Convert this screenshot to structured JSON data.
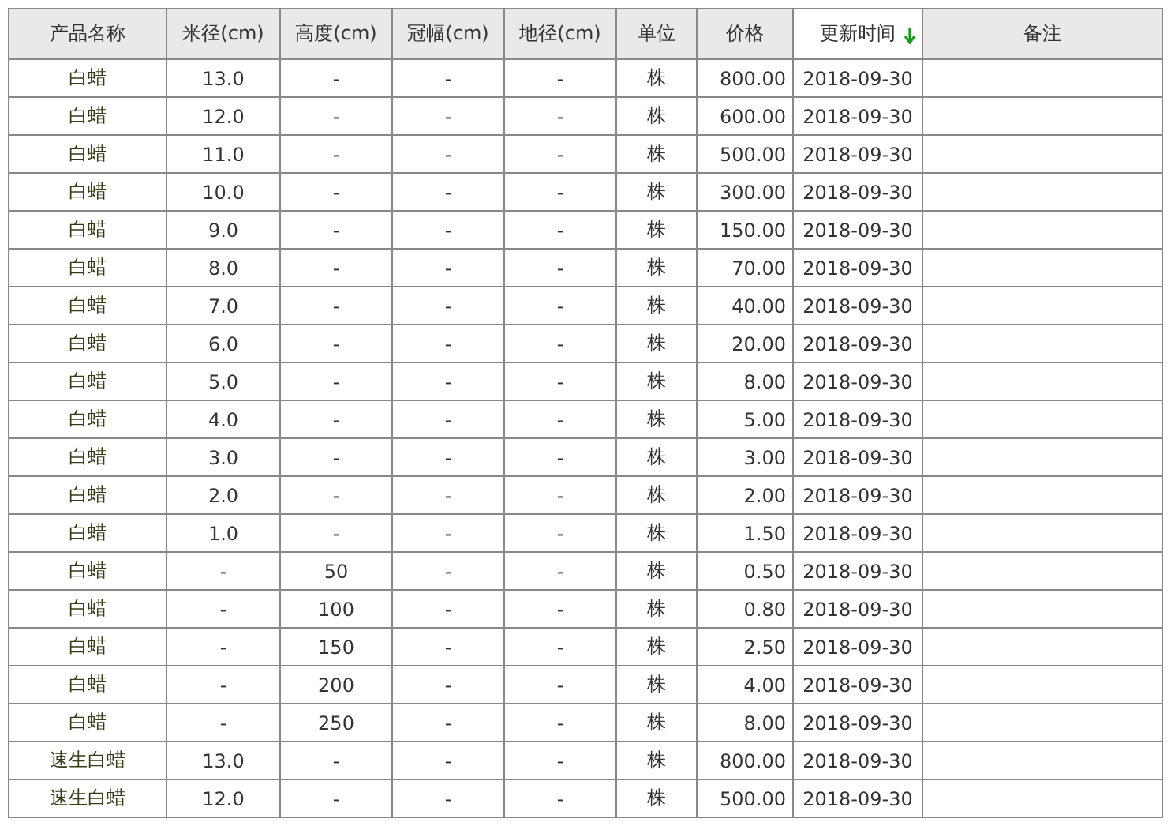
{
  "table": {
    "columns": [
      {
        "label": "产品名称",
        "sorted": false
      },
      {
        "label": "米径(cm)",
        "sorted": false
      },
      {
        "label": "高度(cm)",
        "sorted": false
      },
      {
        "label": "冠幅(cm)",
        "sorted": false
      },
      {
        "label": "地径(cm)",
        "sorted": false
      },
      {
        "label": "单位",
        "sorted": false
      },
      {
        "label": "价格",
        "sorted": false
      },
      {
        "label": "更新时间",
        "sorted": true
      },
      {
        "label": "备注",
        "sorted": false
      }
    ],
    "rows": [
      [
        "白蜡",
        "13.0",
        "-",
        "-",
        "-",
        "株",
        "800.00",
        "2018-09-30"
      ],
      [
        "白蜡",
        "12.0",
        "-",
        "-",
        "-",
        "株",
        "600.00",
        "2018-09-30"
      ],
      [
        "白蜡",
        "11.0",
        "-",
        "-",
        "-",
        "株",
        "500.00",
        "2018-09-30"
      ],
      [
        "白蜡",
        "10.0",
        "-",
        "-",
        "-",
        "株",
        "300.00",
        "2018-09-30"
      ],
      [
        "白蜡",
        "9.0",
        "-",
        "-",
        "-",
        "株",
        "150.00",
        "2018-09-30"
      ],
      [
        "白蜡",
        "8.0",
        "-",
        "-",
        "-",
        "株",
        "70.00",
        "2018-09-30"
      ],
      [
        "白蜡",
        "7.0",
        "-",
        "-",
        "-",
        "株",
        "40.00",
        "2018-09-30"
      ],
      [
        "白蜡",
        "6.0",
        "-",
        "-",
        "-",
        "株",
        "20.00",
        "2018-09-30"
      ],
      [
        "白蜡",
        "5.0",
        "-",
        "-",
        "-",
        "株",
        "8.00",
        "2018-09-30"
      ],
      [
        "白蜡",
        "4.0",
        "-",
        "-",
        "-",
        "株",
        "5.00",
        "2018-09-30"
      ],
      [
        "白蜡",
        "3.0",
        "-",
        "-",
        "-",
        "株",
        "3.00",
        "2018-09-30"
      ],
      [
        "白蜡",
        "2.0",
        "-",
        "-",
        "-",
        "株",
        "2.00",
        "2018-09-30"
      ],
      [
        "白蜡",
        "1.0",
        "-",
        "-",
        "-",
        "株",
        "1.50",
        "2018-09-30"
      ],
      [
        "白蜡",
        "-",
        "50",
        "-",
        "-",
        "株",
        "0.50",
        "2018-09-30"
      ],
      [
        "白蜡",
        "-",
        "100",
        "-",
        "-",
        "株",
        "0.80",
        "2018-09-30"
      ],
      [
        "白蜡",
        "-",
        "150",
        "-",
        "-",
        "株",
        "2.50",
        "2018-09-30"
      ],
      [
        "白蜡",
        "-",
        "200",
        "-",
        "-",
        "株",
        "4.00",
        "2018-09-30"
      ],
      [
        "白蜡",
        "-",
        "250",
        "-",
        "-",
        "株",
        "8.00",
        "2018-09-30"
      ],
      [
        "速生白蜡",
        "13.0",
        "-",
        "-",
        "-",
        "株",
        "800.00",
        "2018-09-30"
      ],
      [
        "速生白蜡",
        "12.0",
        "-",
        "-",
        "-",
        "株",
        "500.00",
        "2018-09-30"
      ]
    ]
  }
}
